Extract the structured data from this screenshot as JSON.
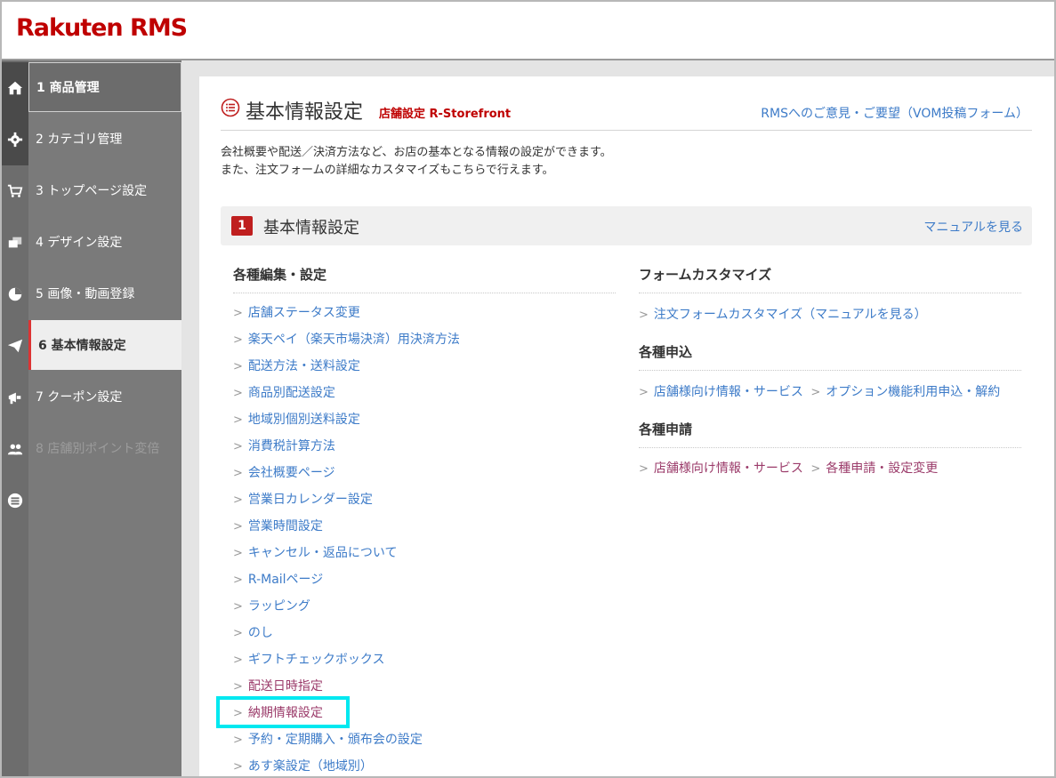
{
  "header": {
    "logo_text": "Rakuten RMS",
    "logo_color": "#bf0000"
  },
  "sidebar": {
    "items": [
      {
        "label": "1  商品管理",
        "icon": "home-icon"
      },
      {
        "label": "2  カテゴリ管理",
        "icon": "gear-icon"
      },
      {
        "label": "3  トップページ設定",
        "icon": "cart-icon"
      },
      {
        "label": "4  デザイン設定",
        "icon": "folders-icon"
      },
      {
        "label": "5  画像・動画登録",
        "icon": "pie-chart-icon"
      },
      {
        "label": "6  基本情報設定",
        "icon": "paper-plane-icon"
      },
      {
        "label": "7  クーポン設定",
        "icon": "megaphone-icon"
      },
      {
        "label": "8  店舗別ポイント変倍",
        "icon": "users-icon"
      }
    ],
    "extra_icon": "list-icon"
  },
  "page": {
    "title": "基本情報設定",
    "subtitle": "店舗設定 R-Storefront",
    "vom_link": "RMSへのご意見・ご要望（VOM投稿フォーム）",
    "description_line1": "会社概要や配送／決済方法など、お店の基本となる情報の設定ができます。",
    "description_line2": "また、注文フォームの詳細なカスタマイズもこちらで行えます。"
  },
  "section": {
    "number": "1",
    "title": "基本情報設定",
    "manual_link": "マニュアルを見る"
  },
  "left_column": {
    "heading": "各種編集・設定",
    "links": [
      "店舗ステータス変更",
      "楽天ペイ（楽天市場決済）用決済方法",
      "配送方法・送料設定",
      "商品別配送設定",
      "地域別個別送料設定",
      "消費税計算方法",
      "会社概要ページ",
      "営業日カレンダー設定",
      "営業時間設定",
      "キャンセル・返品について",
      "R-Mailページ",
      "ラッピング",
      "のし",
      "ギフトチェックボックス",
      "配送日時指定",
      "納期情報設定",
      "予約・定期購入・頒布会の設定",
      "あす楽設定（地域別）"
    ]
  },
  "right_column": {
    "form_heading": "フォームカスタマイズ",
    "form_link": "注文フォームカスタマイズ（マニュアルを見る）",
    "apply_heading": "各種申込",
    "apply_link_prefix": "店舗様向け情報・サービス",
    "apply_link_target": "オプション機能利用申込・解約",
    "request_heading": "各種申請",
    "request_link_prefix": "店舗様向け情報・サービス",
    "request_link_target": "各種申請・設定変更"
  },
  "colors": {
    "accent_red": "#bf1f1f",
    "link_blue": "#3d7bc8",
    "visited": "#9b3b6a",
    "highlight": "#00e8f0"
  }
}
